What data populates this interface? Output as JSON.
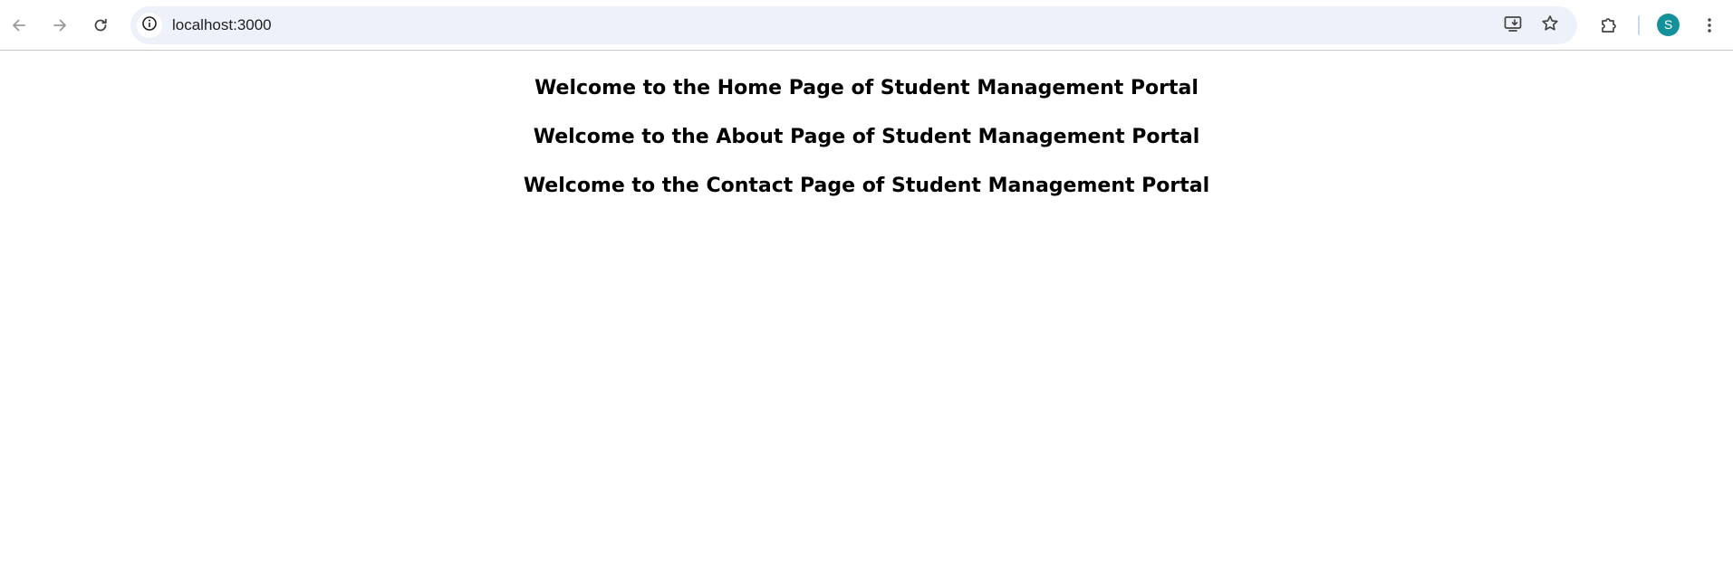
{
  "browser": {
    "url": "localhost:3000",
    "profile_initial": "S",
    "avatar_color": "#14919b",
    "icons": {
      "back": "arrow-left-icon",
      "forward": "arrow-right-icon",
      "reload": "reload-icon",
      "site_info": "info-icon",
      "install": "install-app-icon",
      "bookmark": "star-icon",
      "extensions": "puzzle-icon",
      "menu": "kebab-menu-icon"
    }
  },
  "page": {
    "headings": [
      "Welcome to the Home Page of Student Management Portal",
      "Welcome to the About Page of Student Management Portal",
      "Welcome to the Contact Page of Student Management Portal"
    ]
  }
}
